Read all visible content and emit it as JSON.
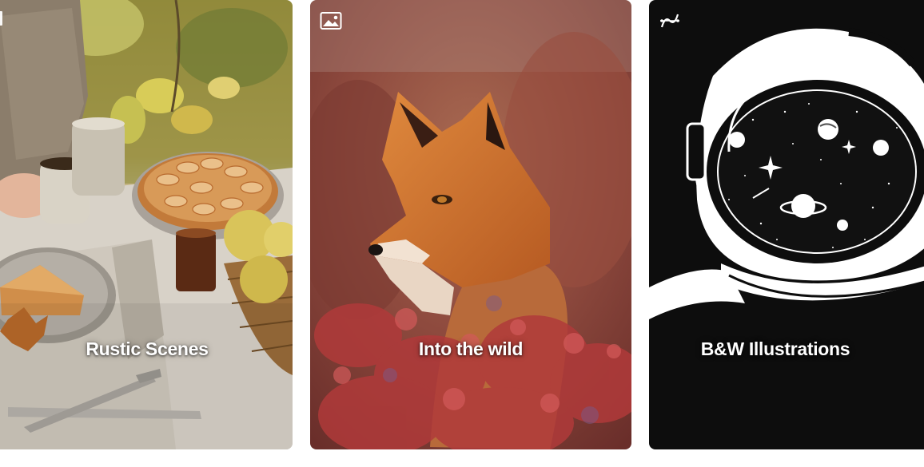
{
  "cards": [
    {
      "title": "Rustic Scenes",
      "type_icon": "image-icon"
    },
    {
      "title": "Into the wild",
      "type_icon": "image-icon"
    },
    {
      "title": "B&W Illustrations",
      "type_icon": "vector-curve-icon"
    }
  ],
  "colors": {
    "title_text": "#ffffff",
    "bw_background": "#0d0d0d",
    "fox_orange": "#c8652a",
    "rustic_linen": "#cfc8bd"
  }
}
